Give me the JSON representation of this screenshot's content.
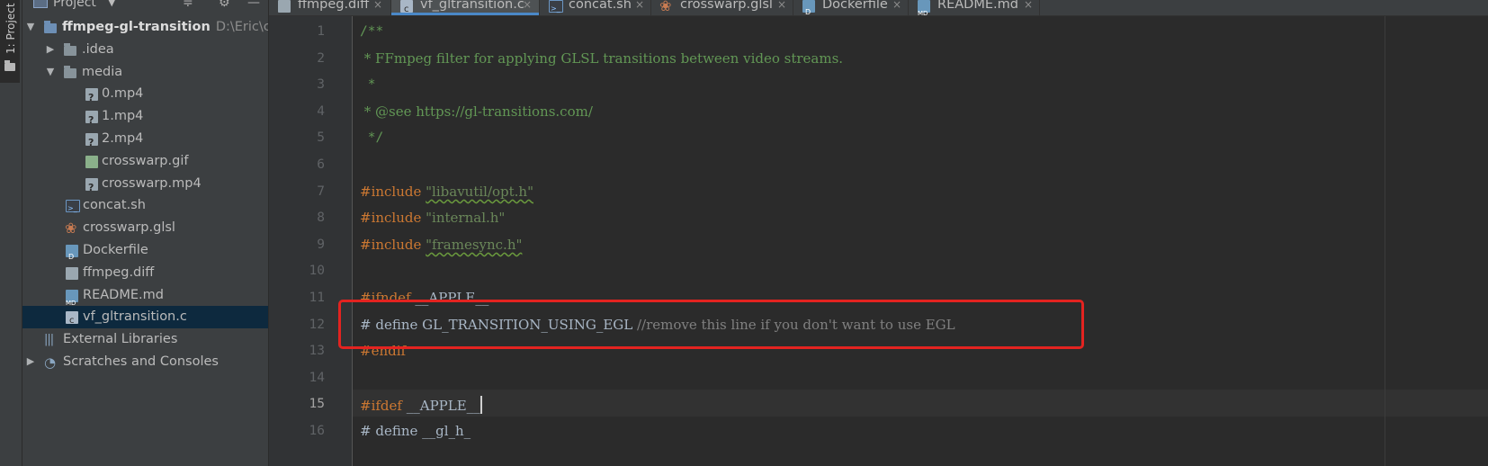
{
  "left_stripe": {
    "label": "1: Project"
  },
  "project_panel": {
    "title": "Project",
    "tree": [
      {
        "label": "ffmpeg-gl-transition",
        "path": "D:\\Eric\\coc",
        "icon": "folder-icon",
        "depth": 0,
        "expanded": true,
        "bold": true
      },
      {
        "label": ".idea",
        "icon": "folder-icon",
        "depth": 1,
        "expanded": false
      },
      {
        "label": "media",
        "icon": "folder-icon",
        "depth": 1,
        "expanded": true
      },
      {
        "label": "0.mp4",
        "icon": "unknown-file-icon",
        "depth": 2
      },
      {
        "label": "1.mp4",
        "icon": "unknown-file-icon",
        "depth": 2
      },
      {
        "label": "2.mp4",
        "icon": "unknown-file-icon",
        "depth": 2
      },
      {
        "label": "crosswarp.gif",
        "icon": "image-file-icon",
        "depth": 2
      },
      {
        "label": "crosswarp.mp4",
        "icon": "unknown-file-icon",
        "depth": 2
      },
      {
        "label": "concat.sh",
        "icon": "shell-file-icon",
        "depth": 1
      },
      {
        "label": "crosswarp.glsl",
        "icon": "glsl-file-icon",
        "depth": 1
      },
      {
        "label": "Dockerfile",
        "icon": "docker-file-icon",
        "depth": 1
      },
      {
        "label": "ffmpeg.diff",
        "icon": "diff-file-icon",
        "depth": 1
      },
      {
        "label": "README.md",
        "icon": "markdown-file-icon",
        "depth": 1
      },
      {
        "label": "vf_gltransition.c",
        "icon": "c-file-icon",
        "depth": 1,
        "selected": true
      },
      {
        "label": "External Libraries",
        "icon": "library-icon",
        "depth": 0
      },
      {
        "label": "Scratches and Consoles",
        "icon": "scratches-icon",
        "depth": 0,
        "expanded": false
      }
    ]
  },
  "tabs": [
    {
      "label": "ffmpeg.diff",
      "icon": "diff-file-icon",
      "active": false
    },
    {
      "label": "vf_gltransition.c",
      "icon": "c-file-icon",
      "active": true
    },
    {
      "label": "concat.sh",
      "icon": "shell-file-icon",
      "active": false
    },
    {
      "label": "crosswarp.glsl",
      "icon": "glsl-file-icon",
      "active": false
    },
    {
      "label": "Dockerfile",
      "icon": "docker-file-icon",
      "active": false
    },
    {
      "label": "README.md",
      "icon": "markdown-file-icon",
      "active": false
    }
  ],
  "tab_close_glyph": "×",
  "editor": {
    "current_line": 15,
    "line_numbers": [
      "1",
      "2",
      "3",
      "4",
      "5",
      "6",
      "7",
      "8",
      "9",
      "10",
      "11",
      "12",
      "13",
      "14",
      "15",
      "16"
    ],
    "code": {
      "l1": "/**",
      "l2": " * FFmpeg filter for applying GLSL transitions between video streams.",
      "l3": " *",
      "l4": " * @see https://gl-transitions.com/",
      "l5": " */",
      "l7_kw": "#include",
      "l7_str": "\"libavutil/opt.h\"",
      "l8_kw": "#include",
      "l8_str": "\"internal.h\"",
      "l9_kw": "#include",
      "l9_str": "\"framesync.h\"",
      "l11_kw": "#ifndef",
      "l11_arg": "__APPLE__",
      "l12_def": "# define GL_TRANSITION_USING_EGL ",
      "l12_cmt": "//remove this line if you don't want to use EGL",
      "l13_kw": "#endif",
      "l15_kw": "#ifdef",
      "l15_arg": "__APPLE__",
      "l16_def": "# define __gl_h_"
    }
  },
  "annotation_color": "#e32320"
}
